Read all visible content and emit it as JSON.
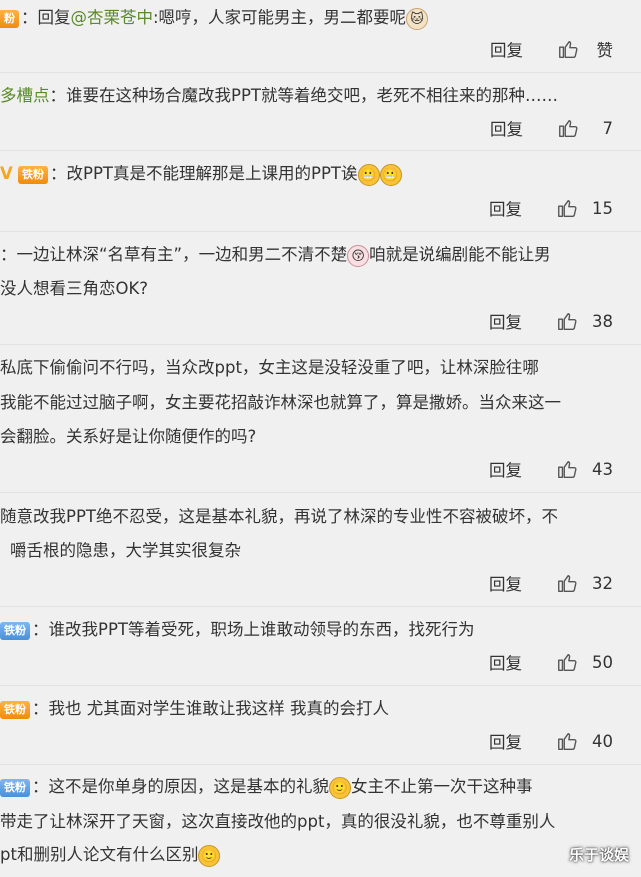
{
  "comments": [
    {
      "lines": [
        "粉：回复",
        "@杏栗苍中",
        ":嗯哼，人家可能男主，男二都要呢"
      ],
      "reply": "回复",
      "like": "赞"
    },
    {
      "name": "多槽点",
      "text": "：谁要在这种场合魔改我PPT就等着绝交吧，老死不相往来的那种……",
      "reply": "回复",
      "like": "7"
    },
    {
      "badge": "铁粉",
      "text": "：改PPT真是不能理解那是上课用的PPT诶",
      "reply": "回复",
      "like": "15"
    },
    {
      "line1": "：一边让林深“名草有主”，一边和男二不清不楚",
      "line1b": "咱就是说编剧能不能让男",
      "line2": "没人想看三角恋OK?",
      "reply": "回复",
      "like": "38"
    },
    {
      "line1": "私底下偷偷问不行吗，当众改ppt，女主这是没轻没重了吧，让林深脸往哪",
      "line2": "我能不能过过脑子啊，女主要花招敲诈林深也就算了，算是撒娇。当众来这一",
      "line3": "会翻脸。关系好是让你随便作的吗?",
      "reply": "回复",
      "like": "43"
    },
    {
      "line1": "随意改我PPT绝不忍受，这是基本礼貌，再说了林深的专业性不容被破坏，不",
      "line2": "嚼舌根的隐患，大学其实很复杂",
      "reply": "回复",
      "like": "32"
    },
    {
      "badge": "铁粉",
      "text": "：谁改我PPT等着受死，职场上谁敢动领导的东西，找死行为",
      "reply": "回复",
      "like": "50"
    },
    {
      "badge": "铁粉",
      "text": "：我也 尤其面对学生谁敢让我这样 我真的会打人",
      "reply": "回复",
      "like": "40"
    },
    {
      "badge": "铁粉",
      "line1a": "：这不是你单身的原因，这是基本的礼貌",
      "line1b": "女主不止第一次干这种事",
      "line2": "带走了让林深开了天窗，这次直接改他的ppt，真的很没礼貌，也不尊重别人",
      "line3": "pt和删别人论文有什么区别"
    }
  ],
  "watermark": "乐于谈娱",
  "colors": {
    "link": "#5a8a2a",
    "badge_orange": "#f08a10",
    "badge_blue": "#4a8fd8"
  }
}
